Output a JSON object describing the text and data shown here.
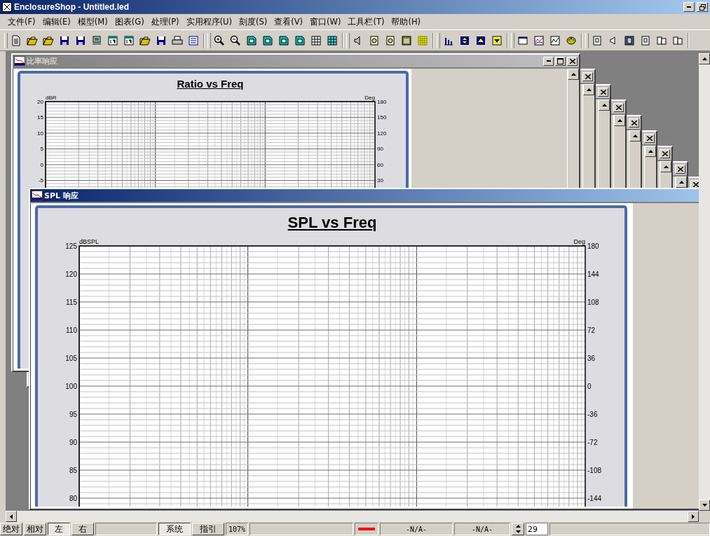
{
  "window": {
    "title": "EnclosureShop - Untitled.led"
  },
  "menu": [
    "文件(F)",
    "编辑(E)",
    "模型(M)",
    "图表(G)",
    "处理(P)",
    "实用程序(U)",
    "刻度(S)",
    "查看(V)",
    "窗口(W)",
    "工具栏(T)",
    "帮助(H)"
  ],
  "documents": [
    {
      "title": "比率响应",
      "active": false,
      "chart": {
        "title": "Ratio vs Freq",
        "left_axis": {
          "label": "dBR",
          "ticks": [
            "20",
            "15",
            "10",
            "5",
            "0",
            "-5"
          ]
        },
        "right_axis": {
          "label": "Deg",
          "ticks": [
            "180",
            "150",
            "120",
            "90",
            "60",
            "30"
          ]
        }
      }
    },
    {
      "title": "SPL 响应",
      "active": true,
      "chart": {
        "title": "SPL vs Freq",
        "left_axis": {
          "label": "dBSPL",
          "ticks": [
            "125",
            "120",
            "115",
            "110",
            "105",
            "100",
            "95",
            "90",
            "85",
            "80"
          ]
        },
        "right_axis": {
          "label": "Deg",
          "ticks": [
            "180",
            "144",
            "108",
            "72",
            "36",
            "0",
            "-36",
            "-72",
            "-108",
            "-144"
          ]
        }
      }
    }
  ],
  "status_bar": {
    "modes": [
      {
        "label": "绝对",
        "selected": false
      },
      {
        "label": "相对",
        "selected": false
      }
    ],
    "channels": [
      {
        "label": "左",
        "selected": true
      },
      {
        "label": "右",
        "selected": false
      }
    ],
    "views": [
      {
        "label": "系统",
        "selected": true
      },
      {
        "label": "指引",
        "selected": false
      }
    ],
    "zoom": "107%",
    "readouts": [
      "-N/A-",
      "-N/A-"
    ],
    "spinner": {
      "value": "29"
    }
  }
}
